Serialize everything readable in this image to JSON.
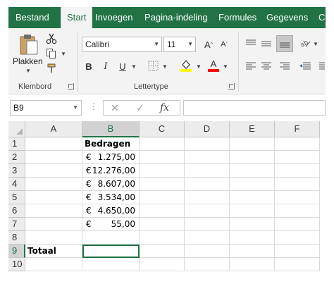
{
  "tabs": [
    {
      "label": "Bestand",
      "active": false
    },
    {
      "label": "Start",
      "active": true
    },
    {
      "label": "Invoegen",
      "active": false
    },
    {
      "label": "Pagina-indeling",
      "active": false
    },
    {
      "label": "Formules",
      "active": false
    },
    {
      "label": "Gegevens",
      "active": false
    },
    {
      "label": "C",
      "active": false
    }
  ],
  "ribbon": {
    "clipboard": {
      "paste_label": "Plakken",
      "group_label": "Klembord",
      "icons": [
        "paste-icon",
        "cut-icon",
        "copy-icon",
        "format-painter-icon"
      ]
    },
    "font": {
      "font_name": "Calibri",
      "font_size": "11",
      "grow_label": "A",
      "shrink_label": "A",
      "bold_label": "B",
      "italic_label": "I",
      "underline_label": "U",
      "font_color_label": "A",
      "group_label": "Lettertype",
      "highlight_color": "#ffff00",
      "font_color": "#ff0000"
    }
  },
  "formula_bar": {
    "name_box": "B9",
    "cancel_symbol": "✕",
    "enter_symbol": "✓",
    "fx_label": "fx",
    "value": ""
  },
  "sheet": {
    "columns": [
      "A",
      "B",
      "C",
      "D",
      "E",
      "F"
    ],
    "selected_column": "B",
    "selected_row": "9",
    "rows": [
      {
        "num": "1",
        "a": "",
        "b_text": "Bedragen",
        "currency": "",
        "amount": ""
      },
      {
        "num": "2",
        "a": "",
        "b_text": "",
        "currency": "€",
        "amount": "1.275,00"
      },
      {
        "num": "3",
        "a": "",
        "b_text": "",
        "currency": "€",
        "amount": "12.276,00"
      },
      {
        "num": "4",
        "a": "",
        "b_text": "",
        "currency": "€",
        "amount": "8.607,00"
      },
      {
        "num": "5",
        "a": "",
        "b_text": "",
        "currency": "€",
        "amount": "3.534,00"
      },
      {
        "num": "6",
        "a": "",
        "b_text": "",
        "currency": "€",
        "amount": "4.650,00"
      },
      {
        "num": "7",
        "a": "",
        "b_text": "",
        "currency": "€",
        "amount": "55,00"
      },
      {
        "num": "8",
        "a": "",
        "b_text": "",
        "currency": "",
        "amount": ""
      },
      {
        "num": "9",
        "a": "Totaal",
        "b_text": "",
        "currency": "",
        "amount": ""
      },
      {
        "num": "10",
        "a": "",
        "b_text": "",
        "currency": "",
        "amount": ""
      }
    ]
  },
  "colors": {
    "accent": "#217346",
    "header_bg": "#ececec",
    "ribbon_bg": "#f3f3f3"
  }
}
